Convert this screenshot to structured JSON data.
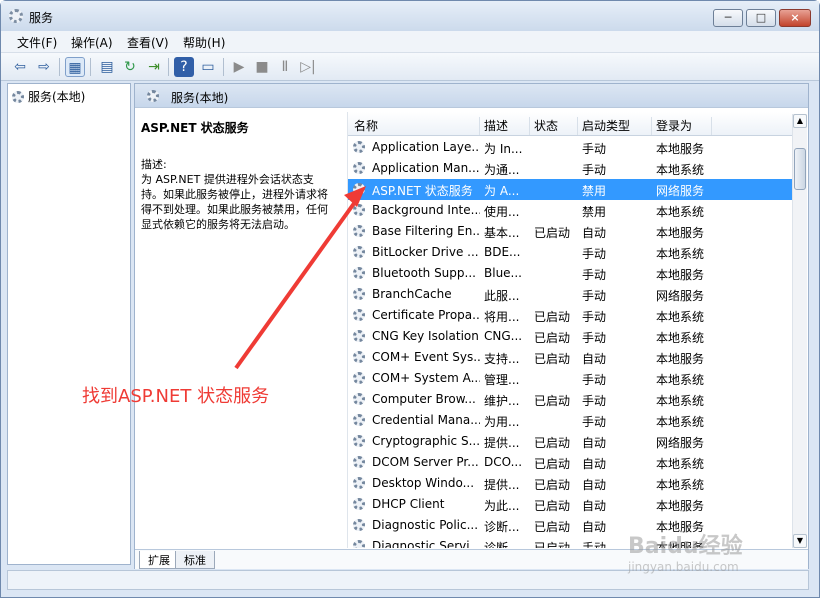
{
  "window": {
    "title": "服务",
    "minimize": "─",
    "maximize": "□",
    "close": "×"
  },
  "menu": [
    "文件(F)",
    "操作(A)",
    "查看(V)",
    "帮助(H)"
  ],
  "toolbar": [
    "back-icon",
    "forward-icon",
    "console-tree-icon",
    "properties-icon",
    "refresh-icon",
    "export-icon",
    "help-icon",
    "view-icon",
    "play-icon",
    "stop-icon",
    "pause-icon",
    "restart-icon"
  ],
  "sidebar": {
    "root": "服务(本地)"
  },
  "content": {
    "header": "服务(本地)",
    "selected_service": "ASP.NET 状态服务",
    "description_label": "描述:",
    "description": "为 ASP.NET 提供进程外会话状态支持。如果此服务被停止，进程外请求将得不到处理。如果此服务被禁用，任何显式依赖它的服务将无法启动。"
  },
  "list": {
    "columns": [
      "名称",
      "描述",
      "状态",
      "启动类型",
      "登录为"
    ],
    "rows": [
      [
        "Application Laye...",
        "为 In...",
        "",
        "手动",
        "本地服务"
      ],
      [
        "Application Man...",
        "为通...",
        "",
        "手动",
        "本地系统"
      ],
      [
        "ASP.NET 状态服务",
        "为 A...",
        "",
        "禁用",
        "网络服务"
      ],
      [
        "Background Inte...",
        "使用...",
        "",
        "禁用",
        "本地系统"
      ],
      [
        "Base Filtering En...",
        "基本...",
        "已启动",
        "自动",
        "本地服务"
      ],
      [
        "BitLocker Drive ...",
        "BDE...",
        "",
        "手动",
        "本地系统"
      ],
      [
        "Bluetooth Supp...",
        "Blue...",
        "",
        "手动",
        "本地服务"
      ],
      [
        "BranchCache",
        "此服...",
        "",
        "手动",
        "网络服务"
      ],
      [
        "Certificate Propa...",
        "将用...",
        "已启动",
        "手动",
        "本地系统"
      ],
      [
        "CNG Key Isolation",
        "CNG...",
        "已启动",
        "手动",
        "本地系统"
      ],
      [
        "COM+ Event Sys...",
        "支持...",
        "已启动",
        "自动",
        "本地服务"
      ],
      [
        "COM+ System A...",
        "管理...",
        "",
        "手动",
        "本地系统"
      ],
      [
        "Computer Brow...",
        "维护...",
        "已启动",
        "手动",
        "本地系统"
      ],
      [
        "Credential Mana...",
        "为用...",
        "",
        "手动",
        "本地系统"
      ],
      [
        "Cryptographic S...",
        "提供...",
        "已启动",
        "自动",
        "网络服务"
      ],
      [
        "DCOM Server Pr...",
        "DCO...",
        "已启动",
        "自动",
        "本地系统"
      ],
      [
        "Desktop Windo...",
        "提供...",
        "已启动",
        "自动",
        "本地系统"
      ],
      [
        "DHCP Client",
        "为此...",
        "已启动",
        "自动",
        "本地服务"
      ],
      [
        "Diagnostic Polic...",
        "诊断...",
        "已启动",
        "自动",
        "本地服务"
      ],
      [
        "Diagnostic Servi...",
        "诊断...",
        "已启动",
        "手动",
        "本地服务"
      ]
    ]
  },
  "tabs": [
    "扩展",
    "标准"
  ],
  "annotation": "找到ASP.NET 状态服务",
  "watermark": [
    "Baidu经验",
    "jingyan.baidu.com"
  ],
  "colors": {
    "selection": "#3399ff",
    "annotation": "#ef3b35"
  }
}
